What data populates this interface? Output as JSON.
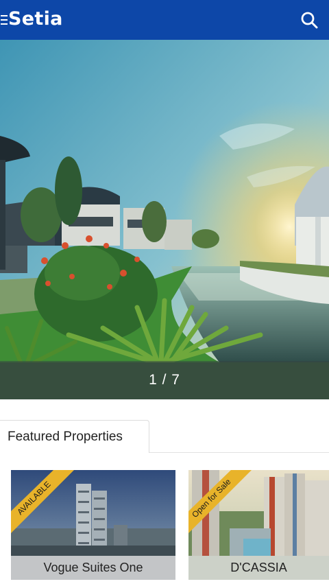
{
  "header": {
    "brand": "Setia",
    "menu_icon": "hamburger-menu-icon",
    "search_icon": "search-icon",
    "background": "#0d47a8"
  },
  "carousel": {
    "counter": "1 / 7",
    "current_slide": 1,
    "total_slides": 7
  },
  "featured": {
    "tab_label": "Featured Properties",
    "cards": [
      {
        "title": "Vogue Suites One",
        "ribbon": "AVAILABLE"
      },
      {
        "title": "D'CASSIA",
        "ribbon": "Open for Sale"
      }
    ],
    "ribbon_color": "#e8b32a"
  }
}
